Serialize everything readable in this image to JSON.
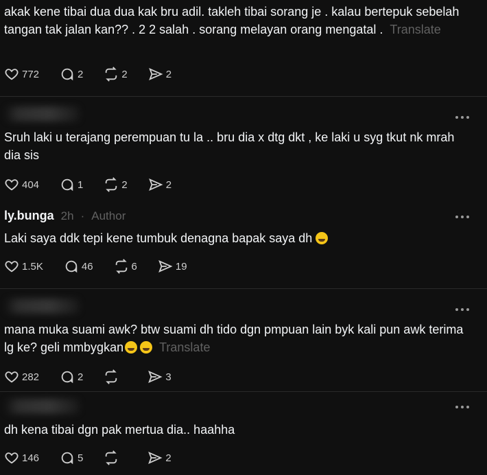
{
  "posts": [
    {
      "author": "",
      "meta": "",
      "text": "akak kene tibai dua dua kak bru adil. takleh tibai sorang je . kalau bertepuk sebelah tangan tak jalan kan?? . 2 2 salah . sorang melayan orang mengatal .",
      "translate": "Translate",
      "likes": "772",
      "replies": "2",
      "reposts": "2",
      "shares": "2"
    },
    {
      "author": "",
      "meta": "",
      "text": "Sruh laki u terajang perempuan tu la .. bru dia x dtg dkt , ke laki u syg tkut nk mrah dia sis",
      "translate": "",
      "likes": "404",
      "replies": "1",
      "reposts": "2",
      "shares": "2"
    },
    {
      "author": "ly.bunga",
      "time": "2h",
      "sep": "·",
      "role": "Author",
      "text": "Laki saya ddk tepi kene tumbuk denagna bapak saya dh",
      "translate": "",
      "likes": "1.5K",
      "replies": "46",
      "reposts": "6",
      "shares": "19"
    },
    {
      "author": "",
      "meta": "",
      "text": "mana muka suami awk? btw suami dh tido dgn pmpuan lain byk kali pun awk terima lg ke? geli mmbygkan",
      "translate": "Translate",
      "likes": "282",
      "replies": "2",
      "reposts": "",
      "shares": "3"
    },
    {
      "author": "",
      "meta": "",
      "text": "dh kena tibai dgn pak mertua dia.. haahha",
      "translate": "",
      "likes": "146",
      "replies": "5",
      "reposts": "",
      "shares": "2"
    }
  ],
  "icons": {
    "like": "heart-icon",
    "reply": "comment-icon",
    "repost": "repost-icon",
    "share": "share-icon",
    "more": "more-icon"
  },
  "colors": {
    "background": "#101010",
    "text": "#f3f5f7",
    "muted": "#616161",
    "divider": "#2a2a2a"
  }
}
